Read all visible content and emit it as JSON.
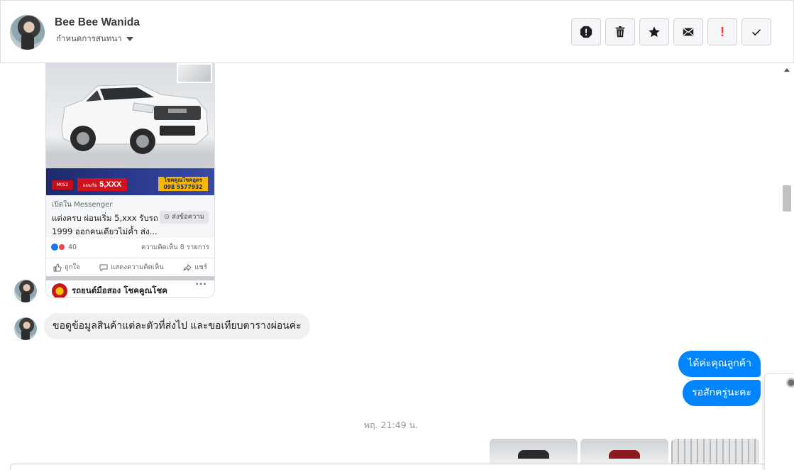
{
  "contact": {
    "name": "Bee Bee Wanida",
    "assign_label": "กำหนดการสนทนา"
  },
  "toolbar": {
    "icons": [
      "spam-icon",
      "trash-icon",
      "star-icon",
      "envelope-icon",
      "exclamation-icon",
      "check-icon"
    ],
    "exclamation_label": "!"
  },
  "post": {
    "promo_code": "M052",
    "promo_price_prefix": "ผ่อนเริ่ม",
    "promo_price": "5,XXX",
    "promo_phone_line1": "โชคคูณโชคอุดร",
    "promo_phone_line2": "098 5577932",
    "source": "เปิดใน Messenger",
    "title": "แต่งครบ ผ่อนเริ่ม 5,xxx รับรถ 1999 ออกคนเดียวไม่ค้ำ ส่ง...",
    "send_message_button": "⊙ ส่งข้อความ",
    "reaction_count": "40",
    "comment_count": "ความคิดเห็น 8 รายการ",
    "action_like": "ถูกใจ",
    "action_comment": "แสดงความคิดเห็น",
    "action_share": "แชร์",
    "page_name": "รถยนต์มือสอง โชคคูณโชค",
    "more": "···"
  },
  "messages": {
    "incoming_1": "ขอดูข้อมูลสินค้าแต่ละตัวที่ส่งไป และขอเทียบตารางผ่อนค่ะ",
    "outgoing_1": "ได้ค่ะคุณลูกค้า",
    "outgoing_2": "รอสักครู่นะคะ"
  },
  "timestamp": "พฤ. 21:49 น.",
  "colors": {
    "outgoing_bubble": "#0084ff",
    "incoming_bubble": "#f1f0f0",
    "alert_red": "#fa383e"
  }
}
